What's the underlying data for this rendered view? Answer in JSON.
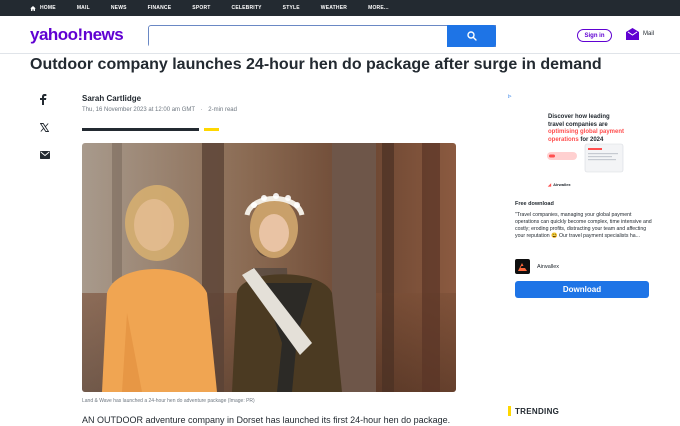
{
  "topnav": {
    "items": [
      "HOME",
      "MAIL",
      "NEWS",
      "FINANCE",
      "SPORT",
      "CELEBRITY",
      "STYLE",
      "WEATHER",
      "MORE..."
    ]
  },
  "header": {
    "logo": "yahoo!news",
    "search_placeholder": "",
    "signin_label": "Sign in",
    "mail_label": "Mail"
  },
  "article": {
    "headline": "Outdoor company launches 24-hour hen do package after surge in demand",
    "author": "Sarah Cartlidge",
    "date": "Thu, 16 November 2023 at 12:00 am GMT",
    "read_time": "2-min read",
    "caption": "Land & Wave has launched a 24-hour hen do adventure package (Image: PR)",
    "body_first_line": "AN OUTDOOR adventure company in Dorset has launched its first 24-hour hen do package."
  },
  "share": {
    "icons": [
      "facebook-icon",
      "x-twitter-icon",
      "email-icon"
    ]
  },
  "ad": {
    "title_line1": "Discover how leading travel companies are",
    "title_highlight": "optimising global payment operations",
    "title_line3": "for 2024",
    "brand_small": "Airwallex",
    "label": "Free download",
    "description": "\"Travel companies, managing your global payment operations can quickly become complex, time intensive and costly; eroding profits, distracting your team and affecting your reputation 😫 Our travel payment specialists ha...",
    "brand": "Airwallex",
    "cta": "Download"
  },
  "sidebar": {
    "trending_label": "TRENDING"
  },
  "colors": {
    "nav_bg": "#232a31",
    "brand_purple": "#6001d2",
    "search_blue": "#1e74e6",
    "accent_yellow": "#ffd700"
  }
}
